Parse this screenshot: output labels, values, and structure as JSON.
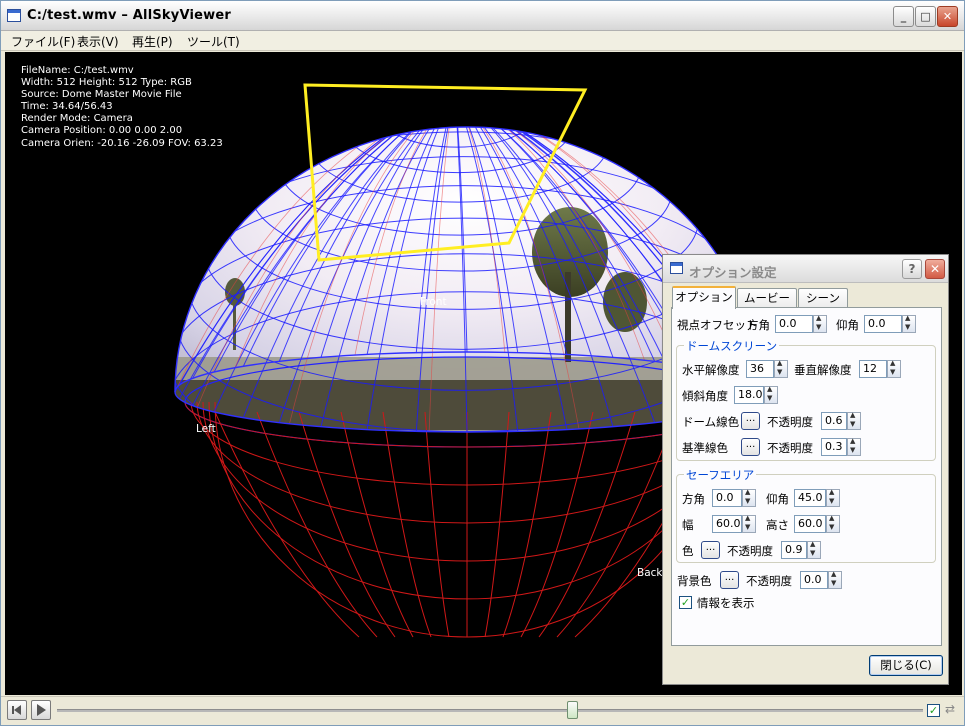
{
  "window": {
    "title": "C:/test.wmv – AllSkyViewer"
  },
  "menu": [
    "ファイル(F)",
    "表示(V)",
    "再生(P)",
    "ツール(T)"
  ],
  "info": [
    "FileName: C:/test.wmv",
    "Width: 512 Height: 512 Type: RGB",
    "Source: Dome Master Movie File",
    "Time: 34.64/56.43",
    "Render Mode: Camera",
    "Camera Position: 0.00 0.00 2.00",
    "Camera Orien: -20.16 -26.09 FOV: 63.23"
  ],
  "dome_labels": {
    "front": "Front",
    "left": "Left",
    "back": "Back"
  },
  "playback": {
    "position": 0.6,
    "loop_checked": true
  },
  "dialog": {
    "title": "オプション設定",
    "help": "?",
    "tabs": [
      "オプション",
      "ムービー",
      "シーン"
    ],
    "active_tab": 0,
    "view_offset": {
      "label": "視点オフセット",
      "azimuth_label": "方角",
      "azimuth": "0.0",
      "elevation_label": "仰角",
      "elevation": "0.0"
    },
    "dome": {
      "title": "ドームスクリーン",
      "h_res_label": "水平解像度",
      "h_res": "36",
      "v_res_label": "垂直解像度",
      "v_res": "12",
      "tilt_label": "傾斜角度",
      "tilt": "18.0",
      "line_color_label": "ドーム線色",
      "opacity_label": "不透明度",
      "line_opacity": "0.6",
      "base_color_label": "基準線色",
      "base_opacity": "0.3"
    },
    "safe_area": {
      "title": "セーフエリア",
      "azimuth_label": "方角",
      "azimuth": "0.0",
      "elevation_label": "仰角",
      "elevation": "45.0",
      "width_label": "幅",
      "width": "60.0",
      "height_label": "高さ",
      "height": "60.0",
      "color_label": "色",
      "opacity_label": "不透明度",
      "opacity": "0.9"
    },
    "background": {
      "color_label": "背景色",
      "opacity_label": "不透明度",
      "opacity": "0.0"
    },
    "show_info": {
      "label": "情報を表示",
      "checked": true
    },
    "dots": "...",
    "close_button": "閉じる(C)"
  }
}
